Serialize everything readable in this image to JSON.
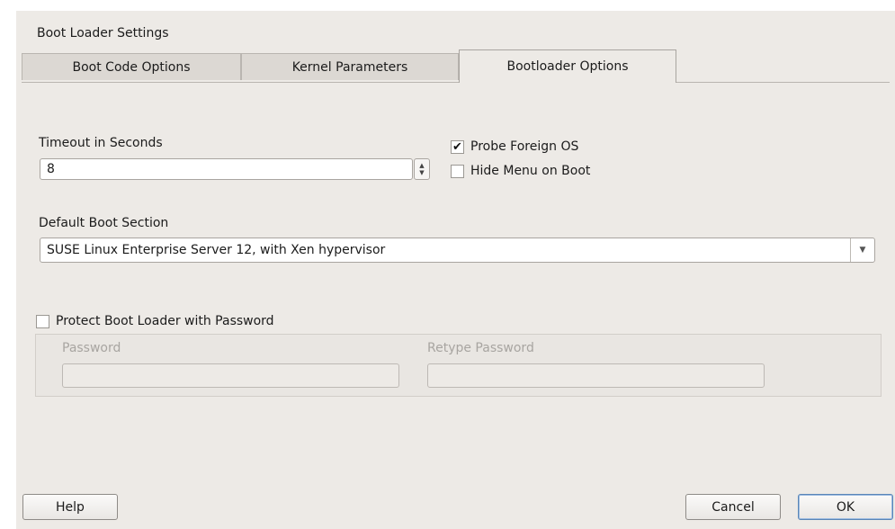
{
  "dialog": {
    "title": "Boot Loader Settings"
  },
  "tabs": [
    {
      "label": "Boot Code Options",
      "active": false
    },
    {
      "label": "Kernel Parameters",
      "active": false
    },
    {
      "label": "Bootloader Options",
      "active": true
    }
  ],
  "timeout": {
    "label": "Timeout in Seconds",
    "value": "8"
  },
  "probe_foreign_os": {
    "label": "Probe Foreign OS",
    "checked": true
  },
  "hide_menu": {
    "label": "Hide Menu on Boot",
    "checked": false
  },
  "default_boot_section": {
    "label": "Default Boot Section",
    "value": "SUSE Linux Enterprise Server 12, with Xen hypervisor"
  },
  "password_protection": {
    "label": "Protect Boot Loader with Password",
    "checked": false,
    "password_label": "Password",
    "password_value": "",
    "retype_label": "Retype Password",
    "retype_value": ""
  },
  "buttons": {
    "help": "Help",
    "cancel": "Cancel",
    "ok": "OK"
  },
  "icons": {
    "checkmark": "✔",
    "spin_up": "▲",
    "spin_down": "▼",
    "dropdown": "▼"
  }
}
